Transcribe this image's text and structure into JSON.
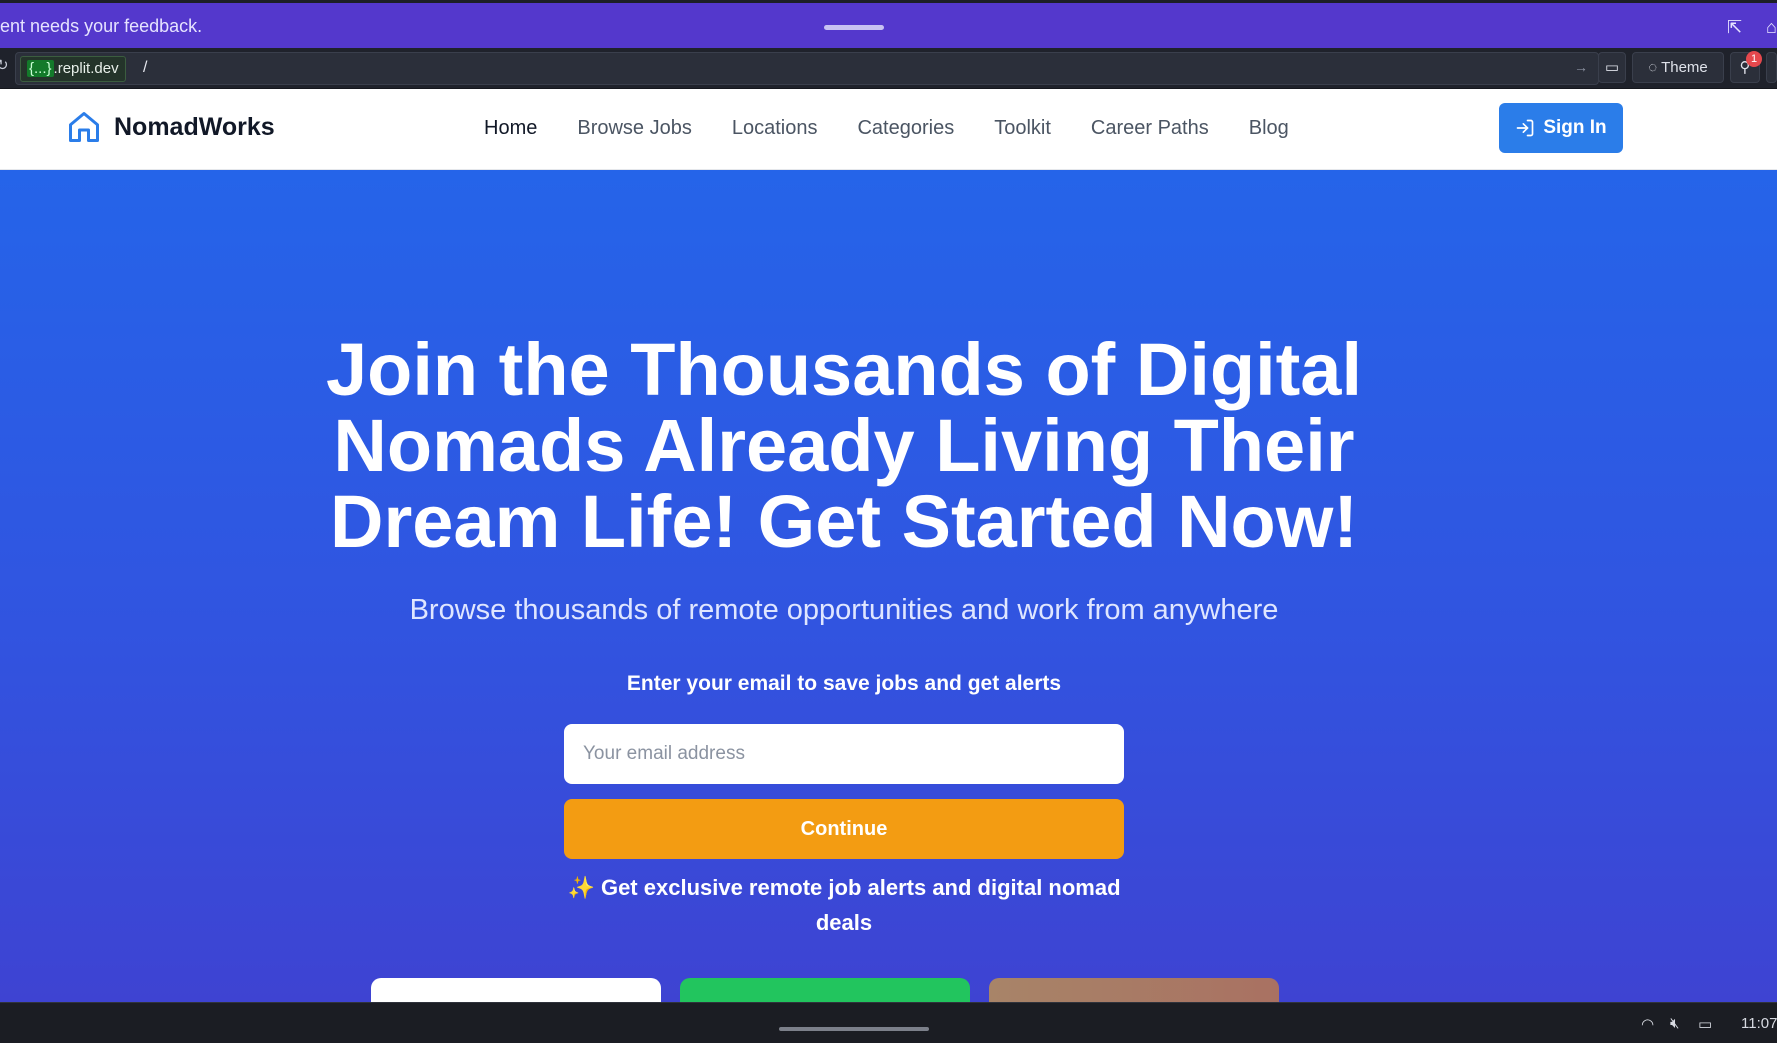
{
  "feedback_bar": {
    "text": "ent needs your feedback."
  },
  "url_bar": {
    "host_highlight": "{...}",
    "host_rest": ".replit.dev",
    "path": "/",
    "theme_label": "Theme",
    "notification_count": "1"
  },
  "header": {
    "brand": "NomadWorks",
    "nav": [
      "Home",
      "Browse Jobs",
      "Locations",
      "Categories",
      "Toolkit",
      "Career Paths",
      "Blog"
    ],
    "active_nav": "Home",
    "signin_label": "Sign In"
  },
  "hero": {
    "title": "Join the Thousands of Digital Nomads Already Living Their Dream Life! Get Started Now!",
    "subtitle": "Browse thousands of remote opportunities and work from anywhere",
    "email_label": "Enter your email to save jobs and get alerts",
    "email_placeholder": "Your email address",
    "continue_label": "Continue",
    "alerts_note": "✨ Get exclusive remote job alerts and digital nomad deals"
  },
  "taskbar": {
    "clock": "11:07"
  },
  "colors": {
    "feedback_bar": "#5438cc",
    "brand_blue": "#2b7de9",
    "hero_top": "#2564e9",
    "hero_bottom": "#3e43d2",
    "cta_orange": "#f39c12",
    "card_green": "#22c55e",
    "card_brown": "#a97c62"
  },
  "icons": {
    "logo": "house-icon",
    "signin": "login-arrow-icon"
  }
}
